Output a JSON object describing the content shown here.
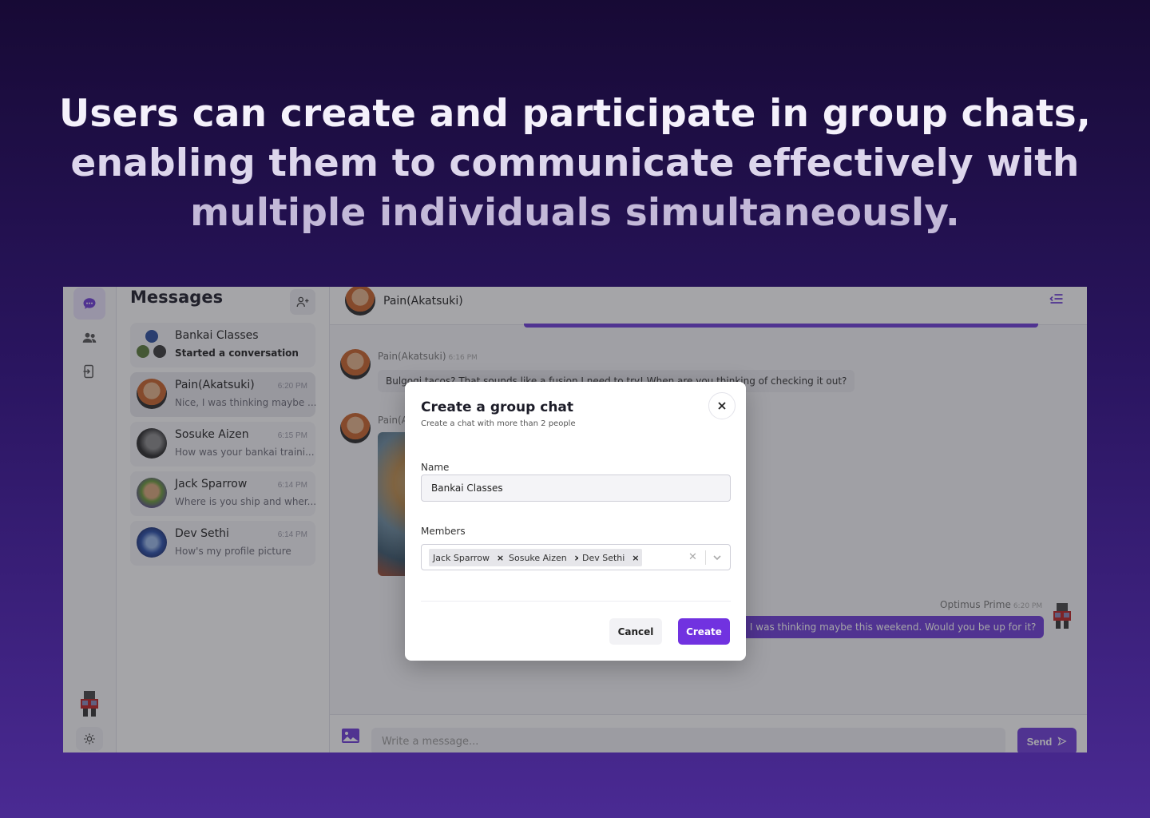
{
  "headline": {
    "line1": "Users can create and participate in group chats,",
    "line2": "enabling them to communicate effectively with",
    "line3": "multiple individuals simultaneously."
  },
  "rail": {
    "icons": [
      "chat-icon",
      "users-icon",
      "logout-icon",
      "sun-icon"
    ]
  },
  "sidebar": {
    "title": "Messages",
    "chats": [
      {
        "name": "Bankai Classes",
        "time": "",
        "preview": "Started a conversation",
        "group": true
      },
      {
        "name": "Pain(Akatsuki)",
        "time": "6:20 PM",
        "preview": "Nice, I was thinking maybe ..."
      },
      {
        "name": "Sosuke Aizen",
        "time": "6:15 PM",
        "preview": "How was your bankai traini..."
      },
      {
        "name": "Jack Sparrow",
        "time": "6:14 PM",
        "preview": "Where is you ship and wher..."
      },
      {
        "name": "Dev Sethi",
        "time": "6:14 PM",
        "preview": "How's my profile picture"
      }
    ]
  },
  "conversation": {
    "contact": "Pain(Akatsuki)",
    "messages": [
      {
        "sender": "Pain(Akatsuki)",
        "time": "6:16 PM",
        "text": "Bulgogi tacos? That sounds like a fusion I need to try! When are you thinking of checking it out?"
      },
      {
        "sender": "Pain(Akatsuki)",
        "time": "",
        "text": ""
      },
      {
        "sender": "Optimus Prime",
        "time": "6:20 PM",
        "text": "Nice, I was thinking maybe this weekend. Would you be up for it?"
      }
    ],
    "composer_placeholder": "Write a message...",
    "send_label": "Send"
  },
  "modal": {
    "title": "Create a group chat",
    "subtitle": "Create a chat with more than 2 people",
    "name_label": "Name",
    "name_value": "Bankai Classes",
    "members_label": "Members",
    "members": [
      "Jack Sparrow",
      "Sosuke Aizen",
      "Dev Sethi"
    ],
    "cancel_label": "Cancel",
    "create_label": "Create"
  },
  "colors": {
    "accent": "#6d3bd8",
    "create_button": "#7132e0",
    "background_top": "#170a35",
    "background_bottom": "#4a2a93"
  }
}
